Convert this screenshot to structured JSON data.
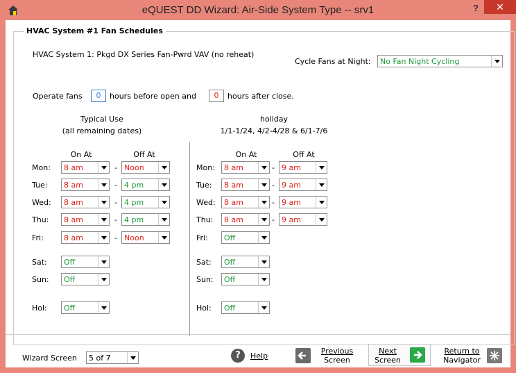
{
  "window": {
    "title": "eQUEST DD Wizard: Air-Side System Type  --  srv1",
    "help_glyph": "?",
    "close_glyph": "✕"
  },
  "group": {
    "title": "HVAC System #1 Fan Schedules",
    "system_label": "HVAC System 1:  Pkgd DX Series Fan-Pwrd VAV (no reheat)",
    "cycle_label": "Cycle Fans at Night:",
    "cycle_value": "No Fan Night Cycling"
  },
  "operate": {
    "prefix": "Operate fans",
    "before_value": "0",
    "middle": "hours before open and",
    "after_value": "0",
    "suffix": "hours after close."
  },
  "typical": {
    "heading1": "Typical Use",
    "heading2": "(all remaining dates)",
    "on_header": "On At",
    "off_header": "Off At",
    "days": [
      {
        "day": "Mon:",
        "on": "8 am",
        "off": "Noon"
      },
      {
        "day": "Tue:",
        "on": "8 am",
        "off": "4 pm"
      },
      {
        "day": "Wed:",
        "on": "8 am",
        "off": "4 pm"
      },
      {
        "day": "Thu:",
        "on": "8 am",
        "off": "4 pm"
      },
      {
        "day": "Fri:",
        "on": "8 am",
        "off": "Noon"
      },
      {
        "day": "Sat:",
        "on": "Off"
      },
      {
        "day": "Sun:",
        "on": "Off"
      },
      {
        "day": "Hol:",
        "on": "Off"
      }
    ]
  },
  "holiday": {
    "heading1": "holiday",
    "heading2": "1/1-1/24,  4/2-4/28  &  6/1-7/6",
    "on_header": "On At",
    "off_header": "Off At",
    "days": [
      {
        "day": "Mon:",
        "on": "8 am",
        "off": "9 am"
      },
      {
        "day": "Tue:",
        "on": "8 am",
        "off": "9 am"
      },
      {
        "day": "Wed:",
        "on": "8 am",
        "off": "9 am"
      },
      {
        "day": "Thu:",
        "on": "8 am",
        "off": "9 am"
      },
      {
        "day": "Fri:",
        "on": "Off"
      },
      {
        "day": "Sat:",
        "on": "Off"
      },
      {
        "day": "Sun:",
        "on": "Off"
      },
      {
        "day": "Hol:",
        "on": "Off"
      }
    ]
  },
  "dash": "-",
  "colors": {
    "red": "#e0201a",
    "green": "#1e9a3a",
    "title_bar": "#e9867a",
    "next_arrow": "#2ba84a"
  },
  "footer": {
    "screen_label": "Wizard Screen",
    "screen_value": "5 of 7",
    "help_label": "Help",
    "help_icon": "?",
    "previous_line1": "Previous",
    "previous_line2": "Screen",
    "next_line1": "Next",
    "next_line2": "Screen",
    "return_line1": "Return to",
    "return_line2": "Navigator"
  }
}
